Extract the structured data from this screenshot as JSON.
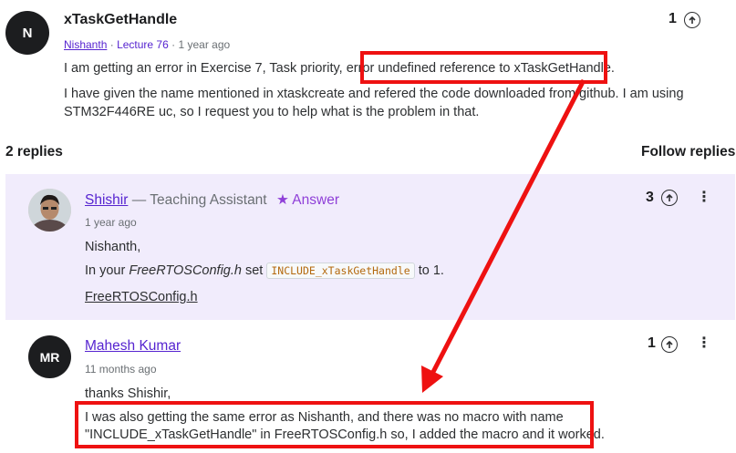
{
  "question": {
    "avatar_initial": "N",
    "title": "xTaskGetHandle",
    "author": "Nishanth",
    "lecture": "Lecture 76",
    "time": "1 year ago",
    "votes": "1",
    "line1_prefix": "I am getting an error in Exercise 7, Task priority, error",
    "line1_highlight": "undefined reference to xTaskGetHandle.",
    "line2": "I have given the name mentioned in xtaskcreate and refered the code downloaded from github. I am using",
    "line3": "STM32F446RE uc, so I request you to help what is the problem in that."
  },
  "replies_header": {
    "count_label": "2 replies",
    "follow_label": "Follow replies"
  },
  "reply1": {
    "author": "Shishir",
    "role": "— Teaching Assistant",
    "answer_badge": "Answer",
    "time": "1 year ago",
    "votes": "3",
    "greeting": "Nishanth,",
    "text_prefix": "In your",
    "file_italic": "FreeRTOSConfig.h",
    "text_set": "set",
    "code": "INCLUDE_xTaskGetHandle",
    "text_suffix": "to 1.",
    "link": "FreeRTOSConfig.h"
  },
  "reply2": {
    "avatar_initials": "MR",
    "author": "Mahesh Kumar",
    "time": "11 months ago",
    "votes": "1",
    "line1": "thanks Shishir,",
    "line2": "I was also getting the same error as Nishanth, and there was no macro with name",
    "line3": "\"INCLUDE_xTaskGetHandle\" in FreeRTOSConfig.h so, I added the macro and it worked."
  },
  "icons": {
    "upvote": "arrow-up-circle-icon",
    "more": "kebab-icon",
    "star": "star-icon"
  },
  "colors": {
    "accent": "#5624d0",
    "answer": "#8f3fd8",
    "highlight": "#ee1111",
    "reply_bg": "#f1ecfc"
  }
}
